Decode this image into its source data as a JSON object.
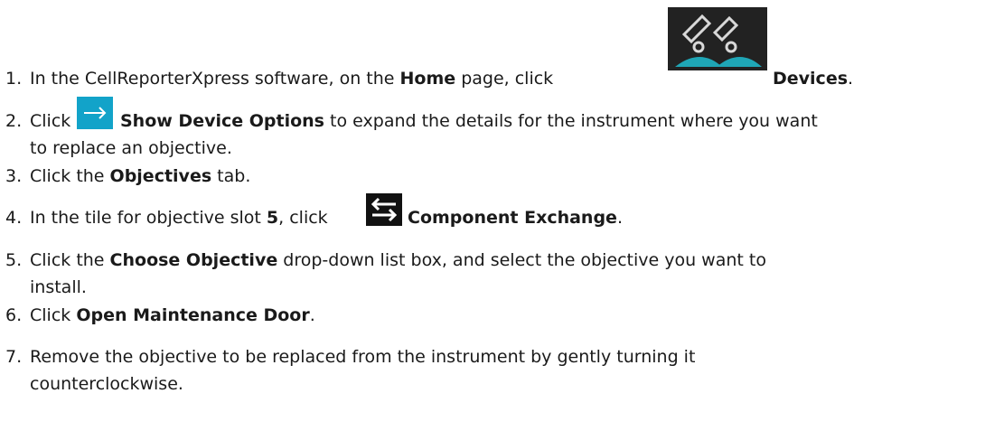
{
  "steps": [
    {
      "num": "1.",
      "a": "In the CellReporterXpress software, on the ",
      "b1": "Home",
      "c": " page, click",
      "icon": "devices-icon",
      "b2": "Devices",
      "d": "."
    },
    {
      "num": "2.",
      "a": "Click",
      "icon": "arrow-right-icon",
      "b1": "Show Device Options",
      "c": " to expand the details for the instrument where you want",
      "line2": "to replace an objective."
    },
    {
      "num": "3.",
      "a": "Click the ",
      "b1": "Objectives",
      "c": " tab."
    },
    {
      "num": "4.",
      "a": "In the tile for objective slot ",
      "b1": "5",
      "c": ", click",
      "icon": "exchange-icon",
      "b2": "Component Exchange",
      "d": "."
    },
    {
      "num": "5.",
      "a": "Click the ",
      "b1": "Choose Objective",
      "c": " drop-down list box, and select the objective you want to",
      "line2": "install."
    },
    {
      "num": "6.",
      "a": "Click ",
      "b1": "Open Maintenance Door",
      "c": "."
    },
    {
      "num": "7.",
      "a": "Remove the objective to be replaced from the instrument by gently turning it",
      "line2": "counterclockwise."
    }
  ]
}
